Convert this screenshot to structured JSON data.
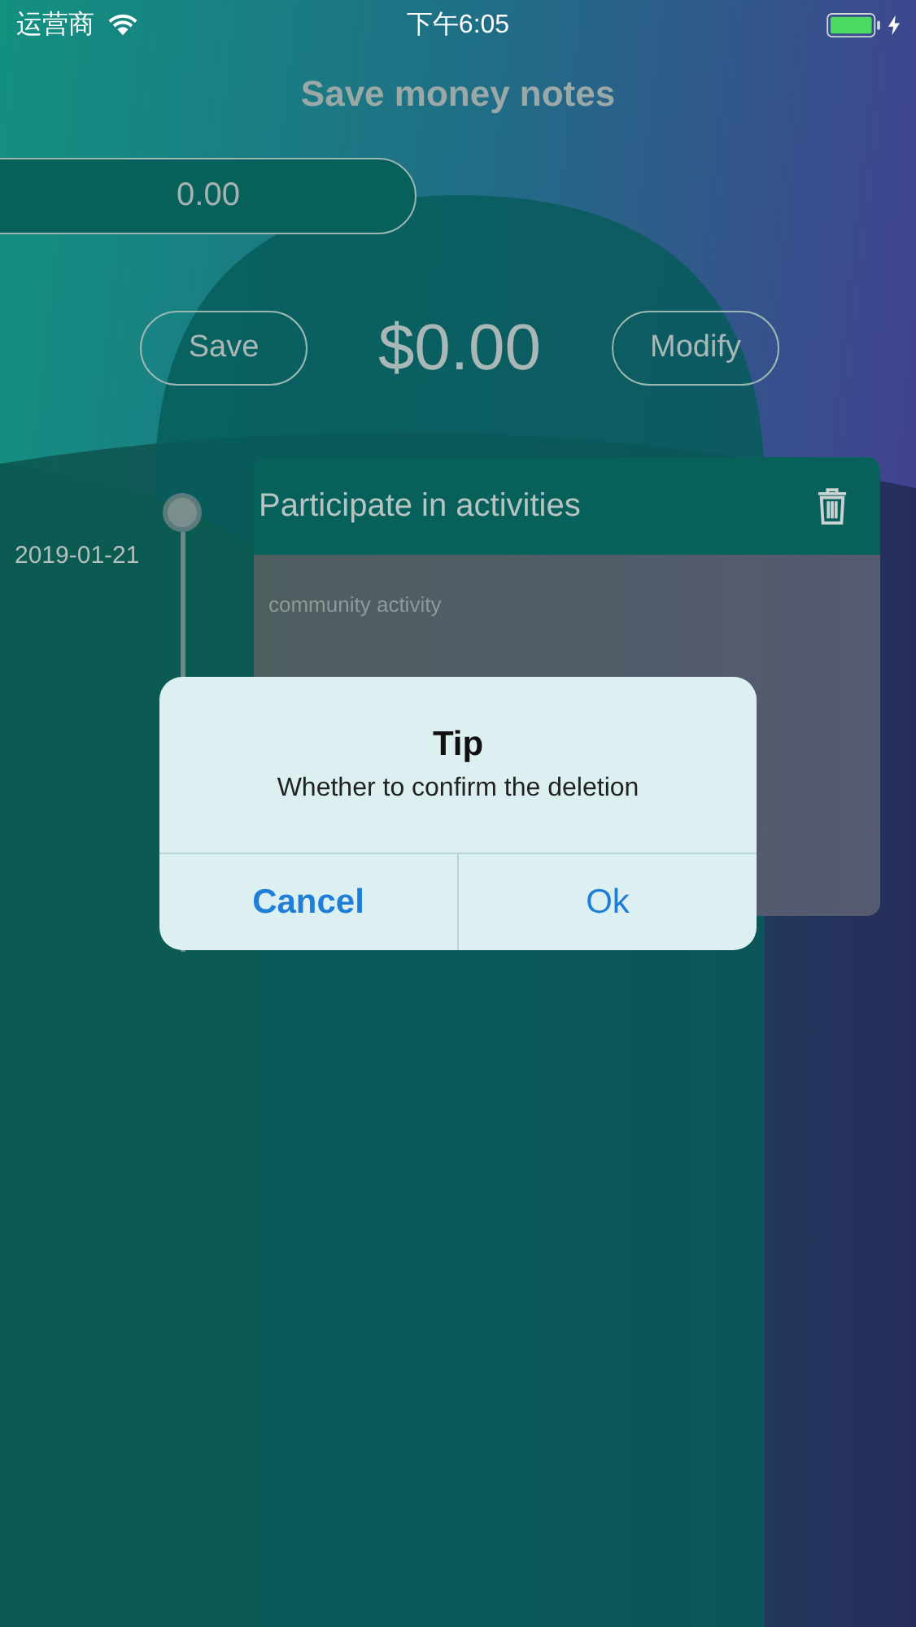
{
  "status_bar": {
    "carrier": "运营商",
    "time": "下午6:05"
  },
  "title": "Save money notes",
  "amount_field": {
    "value": "0.00"
  },
  "actions": [
    {
      "label": "Save"
    },
    {
      "label": "Modify"
    }
  ],
  "balance": "$0.00",
  "entries": [
    {
      "date": "2019-01-21",
      "title": "Participate in activities",
      "note": "community activity"
    }
  ],
  "dialog": {
    "title": "Tip",
    "message": "Whether to confirm the deletion",
    "buttons": [
      {
        "label": "Cancel",
        "kind": "cancel"
      },
      {
        "label": "Ok",
        "kind": "default"
      }
    ]
  }
}
